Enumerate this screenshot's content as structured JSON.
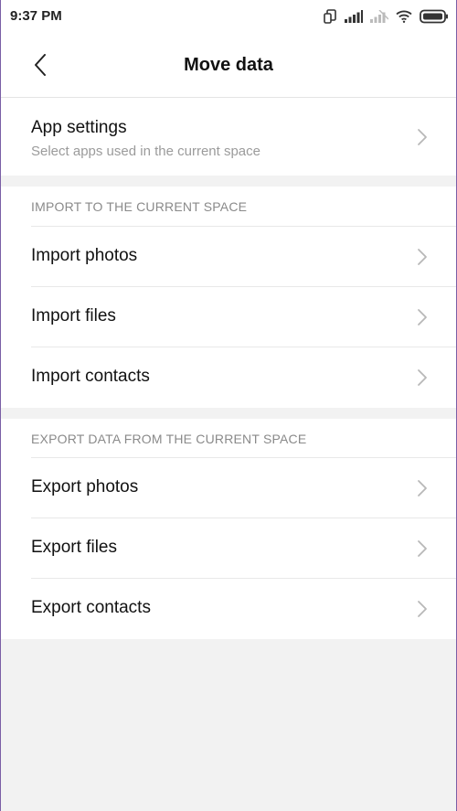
{
  "status_bar": {
    "time": "9:37 PM",
    "icons": [
      "nfc-icon",
      "signal-icon",
      "signal-weak-icon",
      "wifi-icon",
      "battery-icon"
    ]
  },
  "header": {
    "title": "Move data",
    "back_icon": "chevron-left-icon"
  },
  "app_settings": {
    "title": "App settings",
    "subtitle": "Select apps used in the current space"
  },
  "import_section": {
    "header": "IMPORT TO THE CURRENT SPACE",
    "items": [
      {
        "label": "Import photos"
      },
      {
        "label": "Import files"
      },
      {
        "label": "Import contacts"
      }
    ]
  },
  "export_section": {
    "header": "EXPORT DATA FROM THE CURRENT SPACE",
    "items": [
      {
        "label": "Export photos"
      },
      {
        "label": "Export files"
      },
      {
        "label": "Export contacts"
      }
    ]
  },
  "colors": {
    "background": "#f2f2f2",
    "surface": "#ffffff",
    "secondary_text": "#9b9b9b",
    "chevron": "#b8b8b8"
  }
}
